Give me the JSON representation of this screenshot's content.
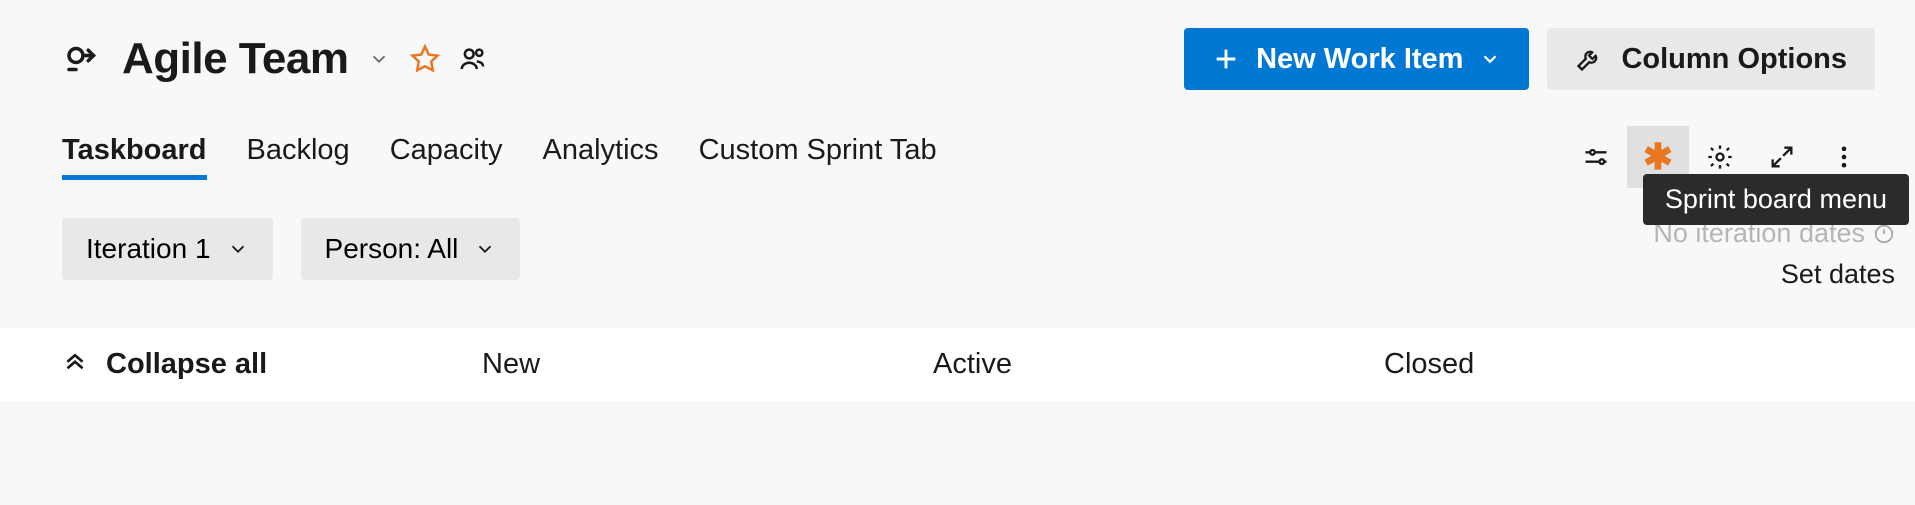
{
  "header": {
    "title": "Agile Team",
    "new_work_item_label": "New Work Item",
    "column_options_label": "Column Options"
  },
  "tabs": [
    {
      "label": "Taskboard",
      "active": true
    },
    {
      "label": "Backlog",
      "active": false
    },
    {
      "label": "Capacity",
      "active": false
    },
    {
      "label": "Analytics",
      "active": false
    },
    {
      "label": "Custom Sprint Tab",
      "active": false
    }
  ],
  "tooltip": "Sprint board menu",
  "filters": {
    "iteration_label": "Iteration 1",
    "person_label": "Person: All"
  },
  "dates": {
    "no_dates_label": "No iteration dates",
    "set_dates_label": "Set dates"
  },
  "columns": {
    "collapse_label": "Collapse all",
    "cols": [
      "New",
      "Active",
      "Closed"
    ]
  },
  "colors": {
    "primary": "#0078d4",
    "accent_orange": "#e87722"
  }
}
